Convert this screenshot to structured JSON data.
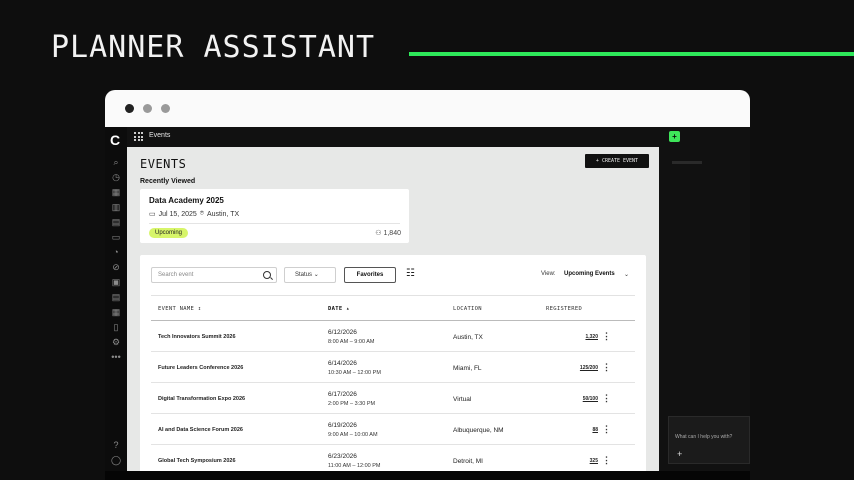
{
  "hero": {
    "title": "PLANNER ASSISTANT"
  },
  "colors": {
    "accent": "#2ee85a",
    "badge": "#d7f56a"
  },
  "topbar": {
    "title": "Events"
  },
  "page": {
    "title": "EVENTS",
    "create_button": "+ CREATE EVENT",
    "recent_label": "Recently Viewed"
  },
  "recent_card": {
    "name": "Data Academy 2025",
    "date": "Jul 15, 2025",
    "location": "Austin, TX",
    "status": "Upcoming",
    "count": "1,840"
  },
  "toolbar": {
    "search_placeholder": "Search event",
    "status_label": "Status",
    "favorites_label": "Favorites",
    "view_label": "View:",
    "view_value": "Upcoming Events"
  },
  "table": {
    "headers": {
      "name": "EVENT NAME",
      "date": "DATE",
      "location": "LOCATION",
      "registered": "REGISTERED"
    },
    "rows": [
      {
        "name": "Tech Innovators Summit 2026",
        "date": "6/12/2026",
        "time": "8:00 AM – 9:00 AM",
        "location": "Austin, TX",
        "registered": "1,320"
      },
      {
        "name": "Future Leaders Conference 2026",
        "date": "6/14/2026",
        "time": "10:30 AM – 12:00 PM",
        "location": "Miami, FL",
        "registered": "125/200"
      },
      {
        "name": "Digital Transformation Expo 2026",
        "date": "6/17/2026",
        "time": "2:00 PM – 3:30 PM",
        "location": "Virtual",
        "registered": "50/100"
      },
      {
        "name": "AI and Data Science Forum 2026",
        "date": "6/19/2026",
        "time": "9:00 AM – 10:00 AM",
        "location": "Albuquerque, NM",
        "registered": "88"
      },
      {
        "name": "Global Tech Symposium 2026",
        "date": "6/23/2026",
        "time": "11:00 AM – 12:00 PM",
        "location": "Detroit, MI",
        "registered": "325"
      }
    ]
  },
  "assistant": {
    "prompt": "What can I help you with?"
  }
}
